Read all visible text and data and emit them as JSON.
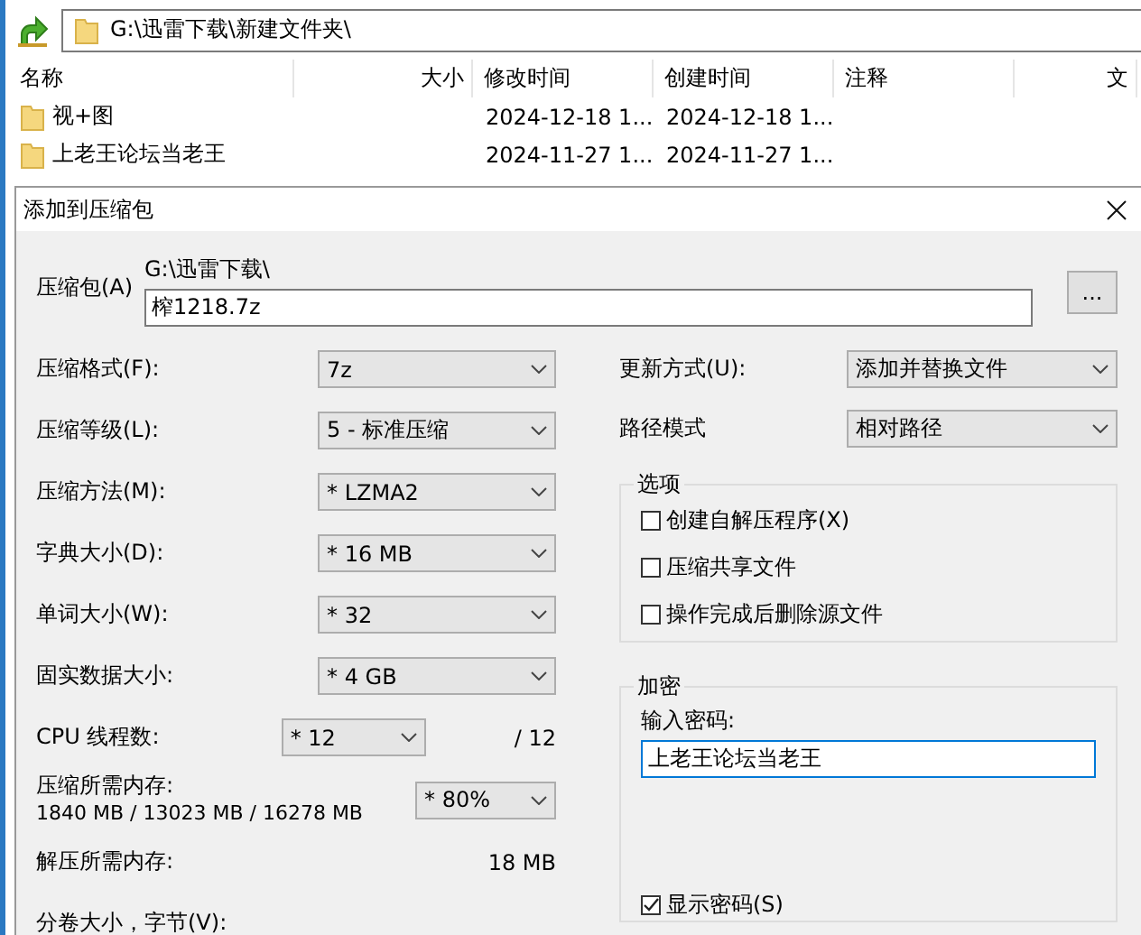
{
  "address_bar": {
    "path": "G:\\迅雷下载\\新建文件夹\\"
  },
  "file_list": {
    "columns": [
      "名称",
      "大小",
      "修改时间",
      "创建时间",
      "注释",
      "文"
    ],
    "rows": [
      {
        "name": "视+图",
        "modified": "2024-12-18 1...",
        "created": "2024-12-18 1..."
      },
      {
        "name": "上老王论坛当老王",
        "modified": "2024-11-27 1...",
        "created": "2024-11-27 1..."
      }
    ]
  },
  "dialog": {
    "title": "添加到压缩包",
    "archive": {
      "label": "压缩包(A)",
      "folder": "G:\\迅雷下载\\",
      "value": "榨1218.7z",
      "browse": "..."
    },
    "left_options": [
      {
        "kind": "combo",
        "label": "压缩格式(F):",
        "value": "7z"
      },
      {
        "kind": "combo",
        "label": "压缩等级(L):",
        "value": "5 - 标准压缩"
      },
      {
        "kind": "combo",
        "label": "压缩方法(M):",
        "value": "* LZMA2"
      },
      {
        "kind": "combo",
        "label": "字典大小(D):",
        "value": "* 16 MB"
      },
      {
        "kind": "combo",
        "label": "单词大小(W):",
        "value": "* 32"
      },
      {
        "kind": "combo",
        "label": "固实数据大小:",
        "value": "* 4 GB"
      },
      {
        "kind": "threads",
        "label": "CPU 线程数:",
        "value": "* 12",
        "suffix": "/ 12"
      },
      {
        "kind": "memory",
        "label": "压缩所需内存:",
        "detail": "1840 MB / 13023 MB / 16278 MB",
        "value": "* 80%"
      },
      {
        "kind": "reading",
        "label": "解压所需内存:",
        "value": "18 MB"
      },
      {
        "kind": "label",
        "label": "分卷大小，字节(V):"
      }
    ],
    "right_options": [
      {
        "label": "更新方式(U):",
        "value": "添加并替换文件"
      },
      {
        "label": "路径模式",
        "value": "相对路径"
      }
    ],
    "options_group": {
      "title": "选项",
      "items": [
        {
          "label": "创建自解压程序(X)",
          "checked": false
        },
        {
          "label": "压缩共享文件",
          "checked": false
        },
        {
          "label": "操作完成后删除源文件",
          "checked": false
        }
      ]
    },
    "encryption": {
      "title": "加密",
      "password_label": "输入密码:",
      "password": "上老王论坛当老王",
      "show_password": {
        "label": "显示密码(S)",
        "checked": true
      }
    }
  }
}
